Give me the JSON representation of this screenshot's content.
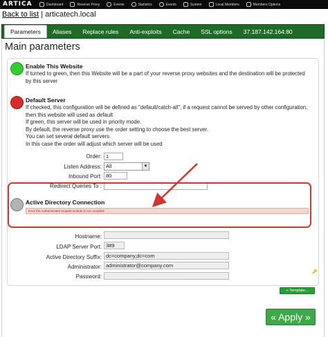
{
  "topbar": {
    "logo": "ARTICA",
    "nav": [
      {
        "label": "Dashboard",
        "icon": "dashboard-icon"
      },
      {
        "label": "Reverse Proxy",
        "icon": "reverse-proxy-icon"
      },
      {
        "label": "Events",
        "icon": "eye-icon"
      },
      {
        "label": "Statistics",
        "icon": "statistics-icon"
      },
      {
        "label": "Events",
        "icon": "eye-icon"
      },
      {
        "label": "System",
        "icon": "system-icon"
      },
      {
        "label": "Local Members",
        "icon": "members-icon"
      },
      {
        "label": "Members Options",
        "icon": "members-options-icon"
      }
    ]
  },
  "breadcrumb": {
    "back": "Back to list",
    "separator": "|",
    "site": "articatech.local"
  },
  "tabs": [
    "Parameters",
    "Aliases",
    "Replace rules",
    "Anti-exploits",
    "Cache",
    "SSL options",
    "37.187.142.164:80"
  ],
  "page_title": "Main parameters",
  "enable": {
    "title": "Enable This Website",
    "desc": "If turned to green, then this Website will be a part of your reverse proxy websites and the destination will be protected by this server"
  },
  "default_server": {
    "title": "Default Server",
    "lines": [
      "If checked, this configuration will be defined as \"default/catch-all\", if a request cannot be served by other configuration, then this website will used as default",
      "If green, this server will be used in priority mode.",
      "By default, the reverse proxy use the order setting to choose the best server.",
      "You can set several default servers.",
      "In this case the order will adjust which server will be used"
    ]
  },
  "fields": {
    "order_label": "Order:",
    "order_value": "1",
    "listen_label": "Listen Address:",
    "listen_value": "All",
    "inbound_label": "Inbound Port:",
    "inbound_value": "80",
    "redirect_label": "Redirect Queries To :",
    "redirect_value": ""
  },
  "ad": {
    "title": "Active Directory Connection",
    "error": "Error the Authenticated request module is not compiled"
  },
  "ldap": {
    "hostname_label": "Hostname:",
    "hostname_value": "",
    "port_label": "LDAP Server Port:",
    "port_value": "389",
    "suffix_label": "Active Directory Suffix:",
    "suffix_value": "dc=company,dc=com",
    "admin_label": "Administrator:",
    "admin_value": "administrator@company.com",
    "password_label": "Password:",
    "password_value": ""
  },
  "buttons": {
    "template": "« Template...",
    "apply": "« Apply »"
  },
  "colors": {
    "tab_bar": "#1d6b27",
    "enabled": "#33cc33",
    "disabled_red": "#dd2b2b",
    "neutral": "#b3b3b3",
    "highlight": "#d23434",
    "apply": "#3ea84a"
  }
}
